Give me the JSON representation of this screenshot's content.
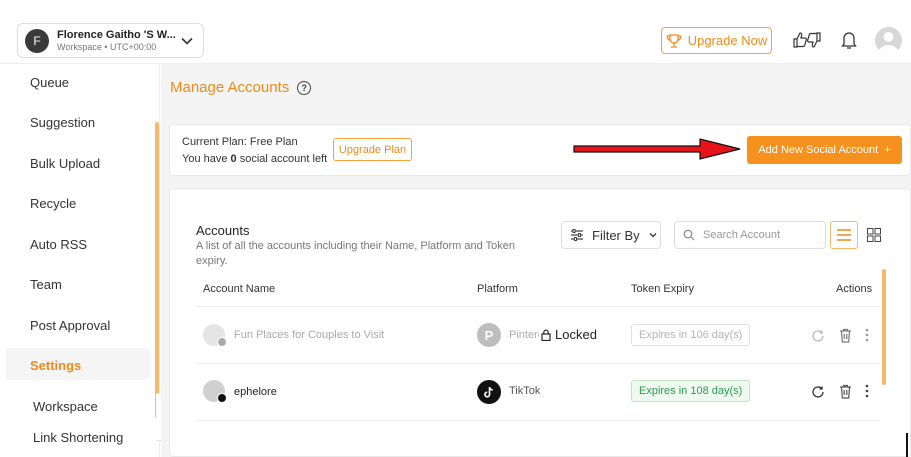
{
  "header": {
    "workspace_initial": "F",
    "workspace_name": "Florence Gaitho 'S W...",
    "workspace_sub": "Workspace • UTC+00:00",
    "upgrade_now": "Upgrade Now"
  },
  "sidebar": {
    "items": [
      {
        "label": "Queue"
      },
      {
        "label": "Suggestion"
      },
      {
        "label": "Bulk Upload"
      },
      {
        "label": "Recycle"
      },
      {
        "label": "Auto RSS"
      },
      {
        "label": "Team"
      },
      {
        "label": "Post Approval"
      },
      {
        "label": "Settings"
      }
    ],
    "sub_items": [
      {
        "label": "Workspace"
      },
      {
        "label": "Link Shortening"
      }
    ]
  },
  "main": {
    "title": "Manage Accounts",
    "plan": {
      "current_plan_label": "Current Plan:",
      "current_plan_value": "Free Plan",
      "you_have": "You have",
      "count": "0",
      "social_left": "social account left",
      "upgrade_plan": "Upgrade Plan",
      "add_account": "Add New Social Account"
    },
    "accounts": {
      "title": "Accounts",
      "description": "A list of all the accounts including their Name, Platform and Token expiry.",
      "filter_label": "Filter By",
      "search_placeholder": "Search Account",
      "columns": [
        "Account Name",
        "Platform",
        "Token Expiry",
        "Actions"
      ],
      "rows": [
        {
          "name": "Fun Places for Couples to Visit",
          "platform": "Pinterest",
          "expiry": "Expires in 106 day(s)",
          "locked": "Locked",
          "disabled": true
        },
        {
          "name": "ephelore",
          "platform": "TikTok",
          "expiry": "Expires in 108 day(s)",
          "locked": "",
          "disabled": false
        }
      ]
    }
  },
  "colors": {
    "accent": "#f6911e",
    "accent_text": "#f08a18",
    "expiry_green": "#2e9a4f",
    "arrow_red": "#e8121b"
  }
}
